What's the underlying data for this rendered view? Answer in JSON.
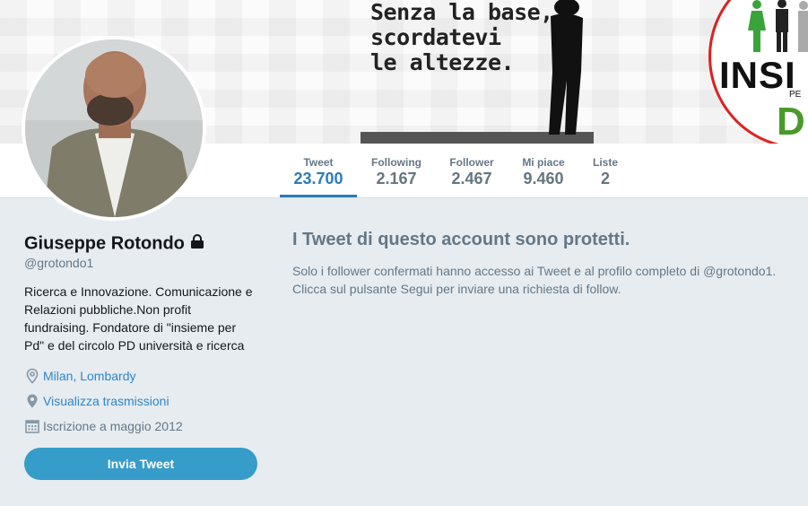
{
  "banner": {
    "line1": "Senza la base,",
    "line2": "scordatevi",
    "line3": "le altezze.",
    "logo_word": "INSI",
    "logo_small": "PE",
    "logo_pd": "D"
  },
  "nav": {
    "stats": [
      {
        "label": "Tweet",
        "value": "23.700"
      },
      {
        "label": "Following",
        "value": "2.167"
      },
      {
        "label": "Follower",
        "value": "2.467"
      },
      {
        "label": "Mi piace",
        "value": "9.460"
      },
      {
        "label": "Liste",
        "value": "2"
      }
    ]
  },
  "profile": {
    "name": "Giuseppe Rotondo",
    "handle": "@grotondo1",
    "bio": "Ricerca e Innovazione. Comunicazione e Relazioni pubbliche.Non profit fundraising. Fondatore di \"insieme per Pd\" e del circolo PD università e ricerca",
    "location": "Milan, Lombardy",
    "broadcasts": "Visualizza trasmissioni",
    "joined": "Iscrizione a maggio 2012",
    "tweet_button": "Invia Tweet"
  },
  "protected": {
    "title": "I Tweet di questo account sono protetti.",
    "body": "Solo i follower confermati hanno accesso ai Tweet e al profilo completo di @grotondo1. Clicca sul pulsante Segui per inviare una richiesta di follow."
  },
  "colors": {
    "accent": "#2b7bb9",
    "button": "#369cc9",
    "background": "#e6ecf0"
  }
}
